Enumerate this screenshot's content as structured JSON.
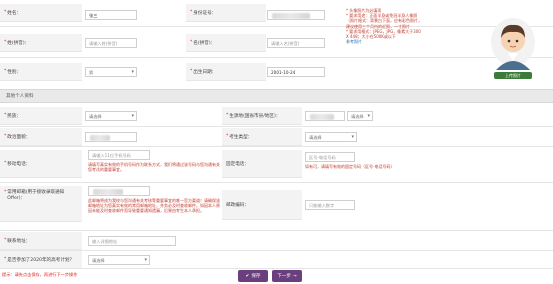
{
  "form": {
    "name_label": "姓名：",
    "name_value": "张三",
    "id_label": "身份证号：",
    "surname_label": "姓(拼音)：",
    "surname_placeholder": "请输入姓(拼音)",
    "givenname_label": "名(拼音)：",
    "givenname_placeholder": "请输入名(拼音)",
    "gender_label": "性别：",
    "gender_value": "男",
    "birth_label": "出生日期：",
    "birth_value": "2001-10-24",
    "photo_hints": [
      "* 头像照片为必填项",
      "* 要求用途：正面半身或免冠半身人像照",
      "（照片格式：背景白下面，应有彩色照片，",
      "建议使用三个月内的近照，一寸照片",
      "* 要求用格式：JPEG，JPG，像素大于300",
      "X 448；大小在500K或以下",
      "参考照片"
    ],
    "upload_label": "上传照片"
  },
  "section": {
    "title": "其他个人资料"
  },
  "other": {
    "ethnicity_label": "民族：",
    "ethnicity_value": "请选择",
    "birthplace_label": "生源地(国省市县/地区)：",
    "birthplace_value": "请选择",
    "political_label": "政治面貌：",
    "student_type_label": "考生类型：",
    "student_type_value": "请选择",
    "mobile_label": "移动电话：",
    "mobile_placeholder": "请输入11位手机号码",
    "mobile_hint": "请填写真实有效的手机号码作为联系方式，我们将通过该号码与您沟通有关您考试的重要事宜。",
    "phone_label": "固定电话：",
    "phone_placeholder": "区号-电话号码",
    "phone_hint": "如有可，请填写有效的固定号码（区号-电话号码）",
    "email_label": "常用邮箱(用于接收录取通知Offer)：",
    "email_hint": "此邮箱将成为我校与您沟通有关考核等重要事宜的唯一官方渠道！请确保该邮箱地址为您真实有效的常用邮箱地址，并务必及时查收邮件。如因本人原因未能及时查收邮件而导致重要通知遗漏，后果由考生本人承担。",
    "postcode_label": "邮政编码：",
    "postcode_placeholder": "只能输入数字",
    "address_label": "联系地址：",
    "address_placeholder": "输入详细地址",
    "exam_label": "是否参加了2020年的高考计划？",
    "exam_value": "请选择"
  },
  "footer": {
    "tip": "提示：请先点击保存，再进行下一步操作",
    "save_label": "保存",
    "next_label": "下一步"
  },
  "colors": {
    "accent": "#6a3f7e",
    "required": "#d9241b",
    "hint": "#c0392b"
  }
}
